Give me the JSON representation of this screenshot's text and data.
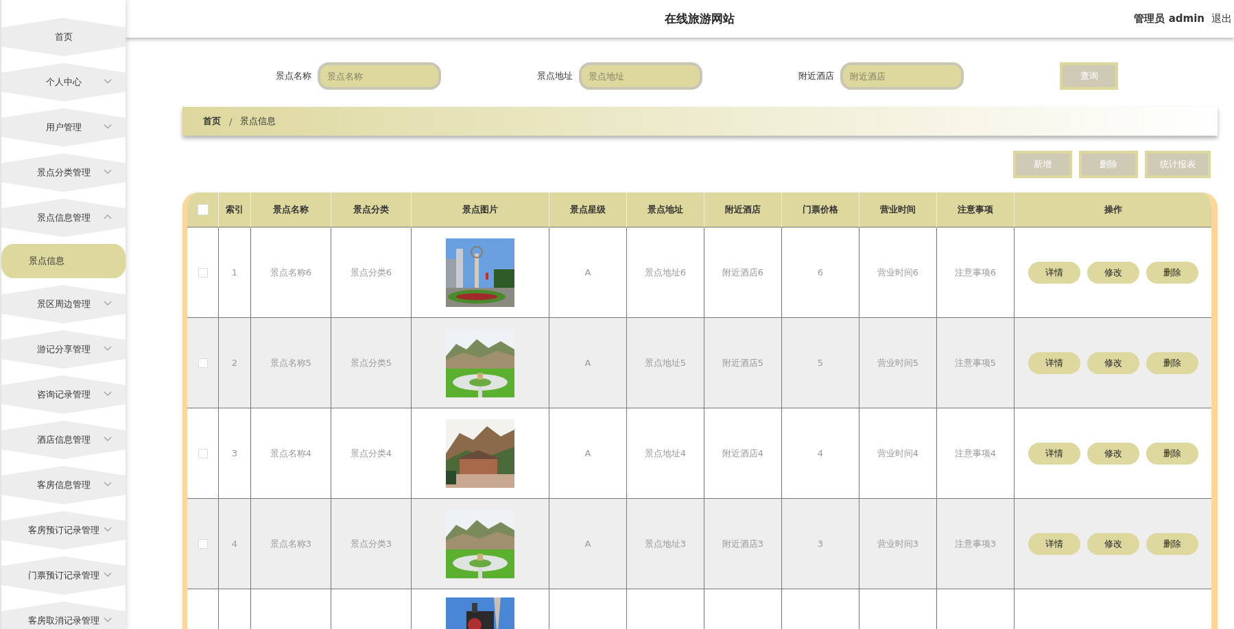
{
  "header": {
    "title": "在线旅游网站",
    "user": "管理员 admin",
    "logout": "退出"
  },
  "sidebar": {
    "items": [
      {
        "label": "首页",
        "kind": "link"
      },
      {
        "label": "个人中心",
        "kind": "menu",
        "expanded": false
      },
      {
        "label": "用户管理",
        "kind": "menu",
        "expanded": false
      },
      {
        "label": "景点分类管理",
        "kind": "menu",
        "expanded": false
      },
      {
        "label": "景点信息管理",
        "kind": "menu",
        "expanded": true,
        "children": [
          {
            "label": "景点信息",
            "selected": true
          }
        ]
      },
      {
        "label": "景区周边管理",
        "kind": "menu",
        "expanded": false
      },
      {
        "label": "游记分享管理",
        "kind": "menu",
        "expanded": false
      },
      {
        "label": "咨询记录管理",
        "kind": "menu",
        "expanded": false
      },
      {
        "label": "酒店信息管理",
        "kind": "menu",
        "expanded": false
      },
      {
        "label": "客房信息管理",
        "kind": "menu",
        "expanded": false
      },
      {
        "label": "客房预订记录管理",
        "kind": "menu",
        "expanded": false
      },
      {
        "label": "门票预订记录管理",
        "kind": "menu",
        "expanded": false
      },
      {
        "label": "客房取消记录管理",
        "kind": "menu",
        "expanded": false
      }
    ]
  },
  "search": {
    "fields": [
      {
        "label": "景点名称",
        "placeholder": "景点名称"
      },
      {
        "label": "景点地址",
        "placeholder": "景点地址"
      },
      {
        "label": "附近酒店",
        "placeholder": "附近酒店"
      }
    ],
    "button": "查询"
  },
  "breadcrumb": {
    "items": [
      "首页",
      "景点信息"
    ],
    "separator": "/"
  },
  "actions": [
    "新增",
    "删除",
    "统计报表"
  ],
  "table": {
    "select_all": {
      "checked": false
    },
    "columns": [
      "索引",
      "景点名称",
      "景点分类",
      "景点图片",
      "景点星级",
      "景点地址",
      "附近酒店",
      "门票价格",
      "营业时间",
      "注意事项",
      "操作"
    ],
    "rows": [
      {
        "checked": false,
        "cells": [
          "1",
          "景点名称6",
          "景点分类6",
          {
            "kind": "picture"
          },
          "A",
          "景点地址6",
          "附近酒店6",
          "6",
          "营业时间6",
          "注意事项6"
        ],
        "buttons": [
          "详情",
          "修改",
          "删除"
        ]
      },
      {
        "checked": false,
        "cells": [
          "2",
          "景点名称5",
          "景点分类5",
          {
            "kind": "picture"
          },
          "A",
          "景点地址5",
          "附近酒店5",
          "5",
          "营业时间5",
          "注意事项5"
        ],
        "buttons": [
          "详情",
          "修改",
          "删除"
        ]
      },
      {
        "checked": false,
        "cells": [
          "3",
          "景点名称4",
          "景点分类4",
          {
            "kind": "picture"
          },
          "A",
          "景点地址4",
          "附近酒店4",
          "4",
          "营业时间4",
          "注意事项4"
        ],
        "buttons": [
          "详情",
          "修改",
          "删除"
        ]
      },
      {
        "checked": false,
        "cells": [
          "4",
          "景点名称3",
          "景点分类3",
          {
            "kind": "picture"
          },
          "A",
          "景点地址3",
          "附近酒店3",
          "3",
          "营业时间3",
          "注意事项3"
        ],
        "buttons": [
          "详情",
          "修改",
          "删除"
        ]
      },
      {
        "cells": [
          null,
          null,
          null,
          {
            "kind": "picture"
          }
        ]
      }
    ]
  }
}
